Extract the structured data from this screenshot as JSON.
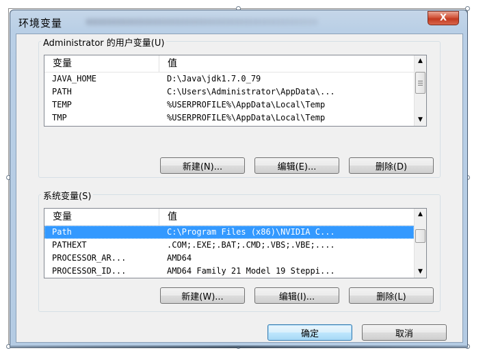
{
  "window": {
    "title": "环境变量",
    "close_glyph": "X"
  },
  "user_vars": {
    "group_label": "Administrator 的用户变量(U)",
    "columns": [
      "变量",
      "值"
    ],
    "rows": [
      {
        "name": "JAVA_HOME",
        "value": "D:\\Java\\jdk1.7.0_79"
      },
      {
        "name": "PATH",
        "value": "C:\\Users\\Administrator\\AppData\\..."
      },
      {
        "name": "TEMP",
        "value": "%USERPROFILE%\\AppData\\Local\\Temp"
      },
      {
        "name": "TMP",
        "value": "%USERPROFILE%\\AppData\\Local\\Temp"
      }
    ],
    "buttons": {
      "new": "新建(N)...",
      "edit": "编辑(E)...",
      "delete": "删除(D)"
    }
  },
  "system_vars": {
    "group_label": "系统变量(S)",
    "columns": [
      "变量",
      "值"
    ],
    "rows": [
      {
        "name": "Path",
        "value": "C:\\Program Files (x86)\\NVIDIA C...",
        "selected": true
      },
      {
        "name": "PATHEXT",
        "value": ".COM;.EXE;.BAT;.CMD;.VBS;.VBE;...."
      },
      {
        "name": "PROCESSOR_AR...",
        "value": "AMD64"
      },
      {
        "name": "PROCESSOR_ID...",
        "value": "AMD64 Family 21 Model 19 Steppi..."
      }
    ],
    "buttons": {
      "new": "新建(W)...",
      "edit": "编辑(I)...",
      "delete": "删除(L)"
    }
  },
  "footer": {
    "ok": "确定",
    "cancel": "取消"
  },
  "icons": {
    "scroll_up": "▲",
    "scroll_down": "▼"
  },
  "colors": {
    "selection": "#3399ff",
    "close_button": "#c9452c",
    "titlebar": "#b9cfe6"
  }
}
